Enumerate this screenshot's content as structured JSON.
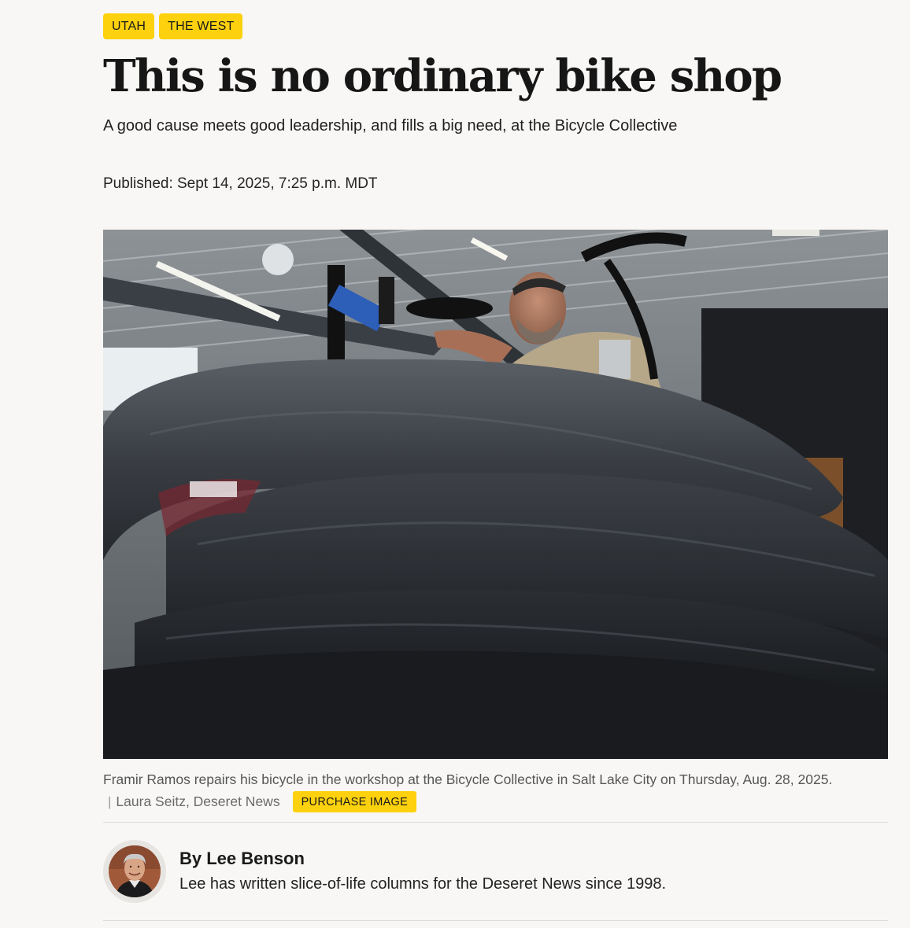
{
  "tags": [
    {
      "label": "UTAH"
    },
    {
      "label": "THE WEST"
    }
  ],
  "headline": "This is no ordinary bike shop",
  "dek": "A good cause meets good leadership, and fills a big need, at the Bicycle Collective",
  "published": "Published: Sept 14, 2025, 7:25 p.m. MDT",
  "photo": {
    "caption": "Framir Ramos repairs his bicycle in the workshop at the Bicycle Collective in Salt Lake City on Thursday, Aug. 28, 2025.",
    "credit_separator": "|",
    "credit": "Laura Seitz, Deseret News",
    "purchase_label": "PURCHASE IMAGE"
  },
  "author": {
    "byline": "By Lee Benson",
    "bio": "Lee has written slice-of-life columns for the Deseret News since 1998."
  },
  "colors": {
    "accent": "#fdd10d",
    "background": "#f8f7f5",
    "text": "#1a1a1a",
    "muted": "#565656"
  }
}
